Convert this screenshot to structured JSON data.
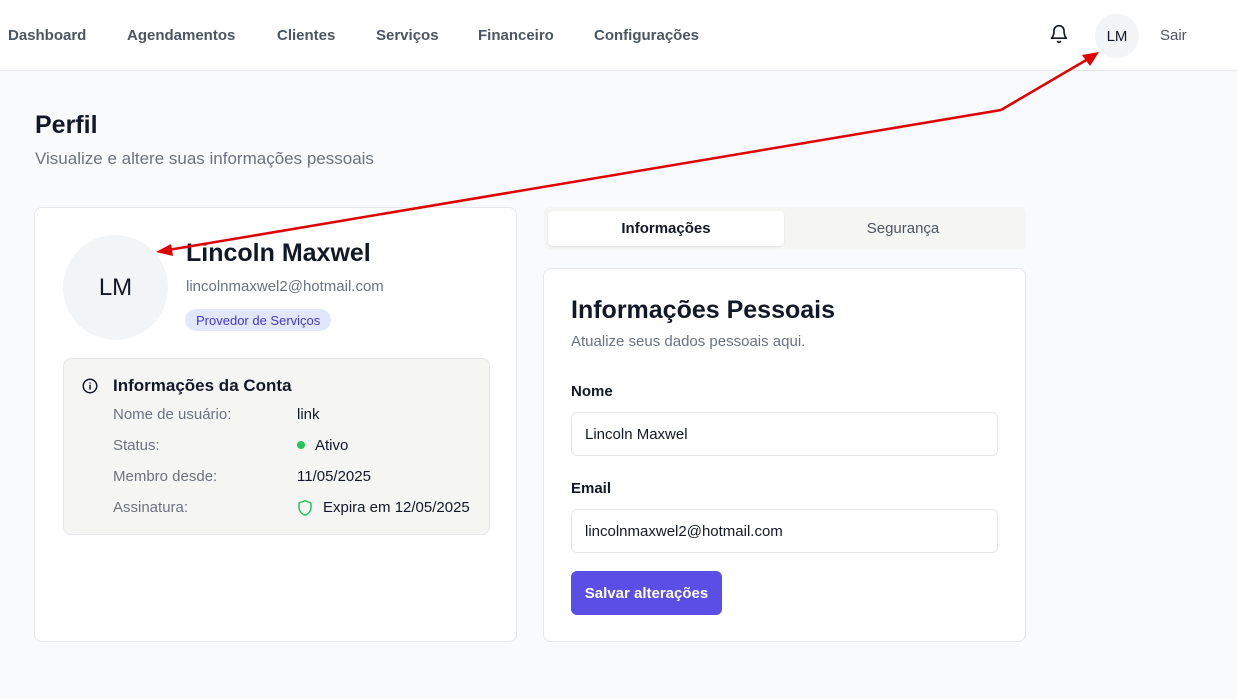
{
  "nav": {
    "items": [
      {
        "label": "Dashboard"
      },
      {
        "label": "Agendamentos"
      },
      {
        "label": "Clientes"
      },
      {
        "label": "Serviços"
      },
      {
        "label": "Financeiro"
      },
      {
        "label": "Configurações"
      }
    ],
    "avatar_initials": "LM",
    "logout_label": "Sair",
    "bell_icon": "bell-icon"
  },
  "page": {
    "title": "Perfil",
    "subtitle": "Visualize e altere suas informações pessoais"
  },
  "profile": {
    "initials": "LM",
    "name": "Lincoln Maxwel",
    "email": "lincolnmaxwel2@hotmail.com",
    "role_badge": "Provedor de Serviços"
  },
  "account_info": {
    "title": "Informações da Conta",
    "icon": "info-icon",
    "rows": [
      {
        "label": "Nome de usuário:",
        "value": "link"
      },
      {
        "label": "Status:",
        "value": "Ativo",
        "status_color": "#22c55e"
      },
      {
        "label": "Membro desde:",
        "value": "11/05/2025"
      },
      {
        "label": "Assinatura:",
        "value": "Expira em 12/05/2025",
        "icon": "shield-icon",
        "icon_color": "#22c55e"
      }
    ]
  },
  "tabs": [
    {
      "label": "Informações",
      "active": true
    },
    {
      "label": "Segurança",
      "active": false
    }
  ],
  "form": {
    "title": "Informações Pessoais",
    "subtitle": "Atualize seus dados pessoais aqui.",
    "name_label": "Nome",
    "name_value": "Lincoln Maxwel",
    "email_label": "Email",
    "email_value": "lincolnmaxwel2@hotmail.com",
    "save_label": "Salvar alterações"
  },
  "colors": {
    "accent": "#5b4ee5",
    "badge_bg": "#e0e7ff",
    "badge_text": "#4338ca",
    "annotation_arrow": "#e00000"
  }
}
